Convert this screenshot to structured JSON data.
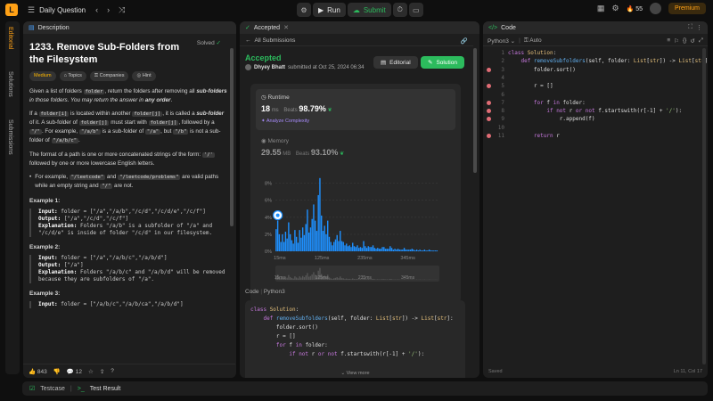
{
  "topbar": {
    "title": "Daily Question",
    "run": "Run",
    "submit": "Submit",
    "streak": "55",
    "premium": "Premium"
  },
  "sidebar": {
    "tabs": [
      "Editorial",
      "Solutions",
      "Submissions"
    ]
  },
  "description": {
    "tab": "Description",
    "title": "1233. Remove Sub-Folders from the Filesystem",
    "status": "Solved",
    "tags": [
      "Medium",
      "Topics",
      "Companies",
      "Hint"
    ],
    "p1a": "Given a list of folders",
    "p1code": "folder",
    "p1b": ", return the folders after removing all",
    "p1bold": "sub-folders",
    "p1c": "in those folders. You may return the answer in",
    "p1bold2": "any order",
    "p1d": ".",
    "p2": [
      {
        "t": "If a "
      },
      {
        "c": "folder[i]"
      },
      {
        "t": " is located within another "
      },
      {
        "c": "folder[j]"
      },
      {
        "t": ", it is called a "
      },
      {
        "b": "sub-folder"
      },
      {
        "t": " of it. A sub-folder of "
      },
      {
        "c": "folder[j]"
      },
      {
        "t": " must start with "
      },
      {
        "c": "folder[j]"
      },
      {
        "t": ", followed by a "
      },
      {
        "c": "\"/\""
      },
      {
        "t": ". For example, "
      },
      {
        "c": "\"/a/b\""
      },
      {
        "t": " is a sub-folder of "
      },
      {
        "c": "\"/a\""
      },
      {
        "t": ", but "
      },
      {
        "c": "\"/b\""
      },
      {
        "t": " is not a sub-folder of "
      },
      {
        "c": "\"/a/b/c\""
      },
      {
        "t": "."
      }
    ],
    "p3a": "The format of a path is one or more concatenated strings of the form:",
    "p3code": "'/'",
    "p3b": "followed by one or more lowercase English letters.",
    "bullet": [
      {
        "t": "For example, "
      },
      {
        "c": "\"/leetcode\""
      },
      {
        "t": " and "
      },
      {
        "c": "\"/leetcode/problems\""
      },
      {
        "t": " are valid paths while an empty string and "
      },
      {
        "c": "\"/\""
      },
      {
        "t": " are not."
      }
    ],
    "examples": [
      {
        "h": "Example 1:",
        "lines": [
          {
            "k": "Input:",
            "v": " folder = [\"/a\",\"/a/b\",\"/c/d\",\"/c/d/e\",\"/c/f\"]"
          },
          {
            "k": "Output:",
            "v": " [\"/a\",\"/c/d\",\"/c/f\"]"
          },
          {
            "k": "Explanation:",
            "v": " Folders \"/a/b\" is a subfolder of \"/a\" and \"/c/d/e\" is inside of folder \"/c/d\" in our filesystem."
          }
        ]
      },
      {
        "h": "Example 2:",
        "lines": [
          {
            "k": "Input:",
            "v": " folder = [\"/a\",\"/a/b/c\",\"/a/b/d\"]"
          },
          {
            "k": "Output:",
            "v": " [\"/a\"]"
          },
          {
            "k": "Explanation:",
            "v": " Folders \"/a/b/c\" and \"/a/b/d\" will be removed because they are subfolders of \"/a\"."
          }
        ]
      },
      {
        "h": "Example 3:",
        "lines": [
          {
            "k": "Input:",
            "v": " folder = [\"/a/b/c\",\"/a/b/ca\",\"/a/b/d\"]"
          }
        ]
      }
    ],
    "likes": "843",
    "comments": "12"
  },
  "accepted": {
    "tab": "Accepted",
    "back": "All Submissions",
    "status": "Accepted",
    "user": "Dhyey Bhatt",
    "submitted": "submitted at Oct 25, 2024 06:34",
    "editorial_btn": "Editorial",
    "solution_btn": "Solution",
    "runtime_label": "Runtime",
    "runtime_value": "18",
    "runtime_unit": "ms",
    "beats_label": "Beats",
    "runtime_beats": "98.79%",
    "analyze": "Analyze Complexity",
    "memory_label": "Memory",
    "memory_value": "29.55",
    "memory_unit": "MB",
    "memory_beats": "93.10%",
    "code_label": "Code",
    "code_lang": "Python3",
    "view_more": "View more",
    "code_lines": [
      [
        {
          "c": "kw",
          "t": "class "
        },
        {
          "c": "ty",
          "t": "Solution"
        },
        {
          "c": "pl",
          "t": ":"
        }
      ],
      [
        {
          "c": "pl",
          "t": "    "
        },
        {
          "c": "kw",
          "t": "def "
        },
        {
          "c": "fn",
          "t": "removeSubfolders"
        },
        {
          "c": "pl",
          "t": "(self, folder: "
        },
        {
          "c": "ty",
          "t": "List"
        },
        {
          "c": "pl",
          "t": "["
        },
        {
          "c": "ty",
          "t": "str"
        },
        {
          "c": "pl",
          "t": "]) -> "
        },
        {
          "c": "ty",
          "t": "List"
        },
        {
          "c": "pl",
          "t": "["
        },
        {
          "c": "ty",
          "t": "str"
        },
        {
          "c": "pl",
          "t": "]:"
        }
      ],
      [
        {
          "c": "pl",
          "t": "        folder.sort()"
        }
      ],
      [
        {
          "c": "pl",
          "t": ""
        }
      ],
      [
        {
          "c": "pl",
          "t": "        r = []"
        }
      ],
      [
        {
          "c": "pl",
          "t": ""
        }
      ],
      [
        {
          "c": "pl",
          "t": "        "
        },
        {
          "c": "kw",
          "t": "for "
        },
        {
          "c": "pl",
          "t": "f "
        },
        {
          "c": "kw",
          "t": "in "
        },
        {
          "c": "pl",
          "t": "folder:"
        }
      ],
      [
        {
          "c": "pl",
          "t": "            "
        },
        {
          "c": "kw",
          "t": "if not "
        },
        {
          "c": "pl",
          "t": "r "
        },
        {
          "c": "kw",
          "t": "or not "
        },
        {
          "c": "pl",
          "t": "f.startswith(r[-1] + "
        },
        {
          "c": "st",
          "t": "'/'"
        },
        {
          "c": "pl",
          "t": "):"
        }
      ]
    ]
  },
  "chart_data": {
    "type": "bar",
    "title": "",
    "xlabel": "",
    "ylabel": "",
    "yticks": [
      "0%",
      "2%",
      "4%",
      "6%",
      "8%"
    ],
    "ylim": [
      0,
      9
    ],
    "xticks": [
      "15ms",
      "125ms",
      "235ms",
      "345ms"
    ],
    "xlim": [
      0,
      420
    ],
    "bar_width_ms": 4,
    "x": [
      2,
      6,
      10,
      14,
      18,
      22,
      26,
      30,
      34,
      38,
      42,
      46,
      50,
      54,
      58,
      62,
      66,
      70,
      74,
      78,
      82,
      86,
      90,
      94,
      98,
      102,
      106,
      110,
      114,
      118,
      122,
      126,
      130,
      134,
      138,
      142,
      146,
      150,
      154,
      158,
      162,
      166,
      170,
      174,
      178,
      182,
      186,
      190,
      194,
      198,
      202,
      206,
      210,
      214,
      218,
      222,
      226,
      230,
      234,
      238,
      242,
      246,
      250,
      254,
      258,
      262,
      266,
      270,
      274,
      278,
      282,
      286,
      290,
      294,
      298,
      302,
      306,
      310,
      314,
      318,
      322,
      326,
      330,
      334,
      338,
      342,
      346,
      350,
      354,
      358,
      362,
      366,
      370,
      374,
      378,
      382,
      386,
      390,
      394,
      398,
      402,
      406,
      410,
      414
    ],
    "values": [
      2.6,
      3.6,
      2.0,
      1.1,
      2.0,
      1.1,
      2.3,
      1.5,
      3.4,
      2.0,
      1.3,
      0.9,
      2.5,
      1.7,
      1.0,
      2.5,
      1.6,
      2.8,
      1.9,
      3.2,
      4.9,
      2.2,
      2.8,
      3.8,
      5.5,
      3.6,
      2.4,
      6.6,
      8.6,
      4.2,
      2.4,
      3.0,
      2.0,
      3.6,
      1.7,
      1.1,
      0.7,
      1.1,
      1.4,
      1.9,
      1.2,
      2.4,
      1.2,
      1.1,
      0.7,
      0.9,
      0.6,
      0.7,
      0.5,
      1.0,
      0.6,
      0.5,
      0.7,
      0.4,
      0.5,
      0.4,
      1.2,
      0.6,
      0.4,
      0.6,
      0.5,
      0.5,
      0.7,
      0.4,
      0.3,
      0.4,
      0.3,
      0.3,
      0.5,
      0.5,
      0.3,
      0.3,
      0.3,
      0.6,
      0.4,
      0.2,
      0.3,
      0.2,
      0.3,
      0.2,
      0.2,
      0.2,
      0.4,
      0.2,
      0.2,
      0.2,
      0.2,
      0.3,
      0.2,
      0.1,
      0.2,
      0.1,
      0.2,
      0.1,
      0.1,
      0.2,
      0.1,
      0.1,
      0.2,
      0.1,
      0.1,
      0.1,
      0.1,
      0.1
    ],
    "highlight_x": 6,
    "bar_color": "#1e90ff",
    "grid": true,
    "minimap_xticks": [
      "15ms",
      "125ms",
      "235ms",
      "345ms"
    ]
  },
  "code_panel": {
    "tab": "Code",
    "lang": "Python3",
    "mode": "Auto",
    "saved": "Saved",
    "cursor": "Ln 11, Col 17",
    "lines": [
      {
        "n": "1",
        "bp": false,
        "seg": [
          {
            "c": "kw",
            "t": "class "
          },
          {
            "c": "ty",
            "t": "Solution"
          },
          {
            "c": "pl",
            "t": ":"
          }
        ]
      },
      {
        "n": "2",
        "bp": false,
        "seg": [
          {
            "c": "pl",
            "t": "    "
          },
          {
            "c": "kw",
            "t": "def "
          },
          {
            "c": "fn",
            "t": "removeSubfolders"
          },
          {
            "c": "pl",
            "t": "(self, "
          },
          {
            "c": "pl",
            "t": "folder: "
          },
          {
            "c": "ty",
            "t": "List"
          },
          {
            "c": "pl",
            "t": "["
          },
          {
            "c": "ty",
            "t": "str"
          },
          {
            "c": "pl",
            "t": "]) -> "
          },
          {
            "c": "ty",
            "t": "List"
          },
          {
            "c": "pl",
            "t": "["
          },
          {
            "c": "ty",
            "t": "str"
          },
          {
            "c": "pl",
            "t": "]:"
          }
        ]
      },
      {
        "n": "3",
        "bp": true,
        "seg": [
          {
            "c": "pl",
            "t": "        folder.sort()"
          }
        ]
      },
      {
        "n": "4",
        "bp": false,
        "seg": [
          {
            "c": "pl",
            "t": ""
          }
        ]
      },
      {
        "n": "5",
        "bp": true,
        "seg": [
          {
            "c": "pl",
            "t": "        r = []"
          }
        ]
      },
      {
        "n": "6",
        "bp": false,
        "seg": [
          {
            "c": "pl",
            "t": ""
          }
        ]
      },
      {
        "n": "7",
        "bp": true,
        "seg": [
          {
            "c": "pl",
            "t": "        "
          },
          {
            "c": "kw",
            "t": "for "
          },
          {
            "c": "pl",
            "t": "f "
          },
          {
            "c": "kw",
            "t": "in "
          },
          {
            "c": "pl",
            "t": "folder:"
          }
        ]
      },
      {
        "n": "8",
        "bp": true,
        "seg": [
          {
            "c": "pl",
            "t": "            "
          },
          {
            "c": "kw",
            "t": "if not "
          },
          {
            "c": "pl",
            "t": "r "
          },
          {
            "c": "kw",
            "t": "or not "
          },
          {
            "c": "pl",
            "t": "f.startswith(r[-1] + "
          },
          {
            "c": "st",
            "t": "'/'"
          },
          {
            "c": "pl",
            "t": "):"
          }
        ]
      },
      {
        "n": "9",
        "bp": true,
        "seg": [
          {
            "c": "pl",
            "t": "                r.append(f)"
          }
        ]
      },
      {
        "n": "10",
        "bp": false,
        "seg": [
          {
            "c": "pl",
            "t": ""
          }
        ]
      },
      {
        "n": "11",
        "bp": true,
        "seg": [
          {
            "c": "pl",
            "t": "        "
          },
          {
            "c": "kw",
            "t": "return "
          },
          {
            "c": "pl",
            "t": "r"
          }
        ]
      }
    ]
  },
  "bottom": {
    "testcase": "Testcase",
    "result": "Test Result"
  }
}
